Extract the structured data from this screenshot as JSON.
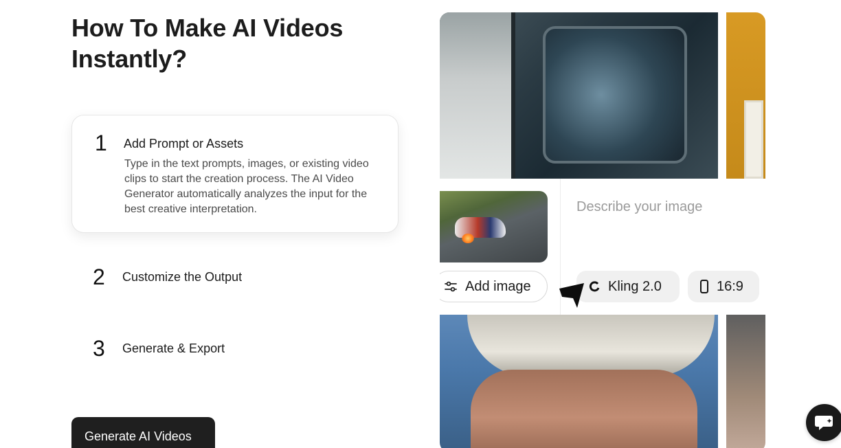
{
  "page_title": "How To Make AI Videos Instantly?",
  "steps": [
    {
      "number": "1",
      "title": "Add Prompt or Assets",
      "description": "Type in the text prompts, images, or existing video clips to start the creation process. The AI Video Generator automatically analyzes the input for the best creative interpretation."
    },
    {
      "number": "2",
      "title": "Customize the Output"
    },
    {
      "number": "3",
      "title": "Generate & Export"
    }
  ],
  "cta_label": "Generate AI Videos",
  "generator": {
    "prompt_placeholder": "Describe your image",
    "add_image_label": "Add image",
    "model_label": "Kling 2.0",
    "ratio_label": "16:9"
  },
  "colors": {
    "cta_background": "#1f1f1f",
    "chip_background": "#f0f0f0",
    "text_primary": "#1a1a1a"
  }
}
